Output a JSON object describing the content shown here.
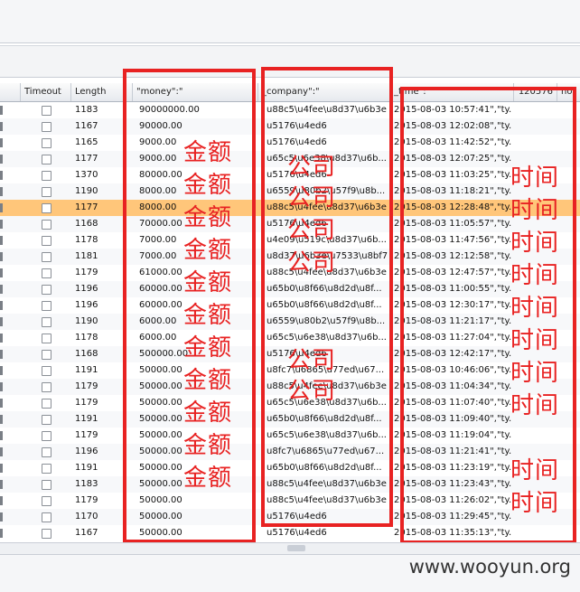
{
  "columns": [
    "Timeout",
    "Length",
    "\"money\":\"",
    "_company\":\"",
    "_time\":",
    "120576",
    "hor"
  ],
  "rows": [
    {
      "length": "1183",
      "money": "90000000.00",
      "company": "u88c5\\u4fee\\u8d37\\u6b3e",
      "time": "2015-08-03 10:57:41\",\"ty..."
    },
    {
      "length": "1167",
      "money": "90000.00",
      "company": "u5176\\u4ed6",
      "time": "2015-08-03 12:02:08\",\"ty..."
    },
    {
      "length": "1165",
      "money": "9000.00",
      "company": "u5176\\u4ed6",
      "time": "2015-08-03 11:42:52\",\"ty..."
    },
    {
      "length": "1177",
      "money": "9000.00",
      "company": "u65c5\\u6e38\\u8d37\\u6b...",
      "time": "2015-08-03 12:07:25\",\"ty..."
    },
    {
      "length": "1370",
      "money": "80000.00",
      "company": "u5176\\u4ed6",
      "time": "2015-08-03 11:03:25\",\"ty..."
    },
    {
      "length": "1190",
      "money": "8000.00",
      "company": "u6559\\u80b2\\u57f9\\u8b...",
      "time": "2015-08-03 11:18:21\",\"ty..."
    },
    {
      "length": "1177",
      "money": "8000.00",
      "company": "u88c5\\u4fee\\u8d37\\u6b3e",
      "time": "2015-08-03 12:28:48\",\"ty..."
    },
    {
      "length": "1168",
      "money": "70000.00",
      "company": "u5176\\u4ed6",
      "time": "2015-08-03 11:05:57\",\"ty..."
    },
    {
      "length": "1178",
      "money": "7000.00",
      "company": "u4e09\\u519c\\u8d37\\u6b...",
      "time": "2015-08-03 11:47:56\",\"ty..."
    },
    {
      "length": "1181",
      "money": "7000.00",
      "company": "u8d37\\u6b3e\\u7533\\u8bf7",
      "time": "2015-08-03 12:12:58\",\"ty..."
    },
    {
      "length": "1179",
      "money": "61000.00",
      "company": "u88c5\\u4fee\\u8d37\\u6b3e",
      "time": "2015-08-03 12:47:57\",\"ty..."
    },
    {
      "length": "1196",
      "money": "60000.00",
      "company": "u65b0\\u8f66\\u8d2d\\u8f...",
      "time": "2015-08-03 11:00:55\",\"ty..."
    },
    {
      "length": "1196",
      "money": "60000.00",
      "company": "u65b0\\u8f66\\u8d2d\\u8f...",
      "time": "2015-08-03 12:30:17\",\"ty..."
    },
    {
      "length": "1190",
      "money": "6000.00",
      "company": "u6559\\u80b2\\u57f9\\u8b...",
      "time": "2015-08-03 11:21:17\",\"ty..."
    },
    {
      "length": "1178",
      "money": "6000.00",
      "company": "u65c5\\u6e38\\u8d37\\u6b...",
      "time": "2015-08-03 11:27:04\",\"ty..."
    },
    {
      "length": "1168",
      "money": "500000.00",
      "company": "u5176\\u4ed6",
      "time": "2015-08-03 12:42:17\",\"ty..."
    },
    {
      "length": "1191",
      "money": "50000.00",
      "company": "u8fc7\\u6865\\u77ed\\u67...",
      "time": "2015-08-03 10:46:06\",\"ty..."
    },
    {
      "length": "1179",
      "money": "50000.00",
      "company": "u88c5\\u4fee\\u8d37\\u6b3e",
      "time": "2015-08-03 11:04:34\",\"ty..."
    },
    {
      "length": "1179",
      "money": "50000.00",
      "company": "u65c5\\u6e38\\u8d37\\u6b...",
      "time": "2015-08-03 11:07:40\",\"ty..."
    },
    {
      "length": "1191",
      "money": "50000.00",
      "company": "u65b0\\u8f66\\u8d2d\\u8f...",
      "time": "2015-08-03 11:09:40\",\"ty..."
    },
    {
      "length": "1179",
      "money": "50000.00",
      "company": "u65c5\\u6e38\\u8d37\\u6b...",
      "time": "2015-08-03 11:19:04\",\"ty..."
    },
    {
      "length": "1196",
      "money": "50000.00",
      "company": "u8fc7\\u6865\\u77ed\\u67...",
      "time": "2015-08-03 11:21:41\",\"ty..."
    },
    {
      "length": "1191",
      "money": "50000.00",
      "company": "u65b0\\u8f66\\u8d2d\\u8f...",
      "time": "2015-08-03 11:23:19\",\"ty..."
    },
    {
      "length": "1183",
      "money": "50000.00",
      "company": "u88c5\\u4fee\\u8d37\\u6b3e",
      "time": "2015-08-03 11:23:43\",\"ty..."
    },
    {
      "length": "1179",
      "money": "50000.00",
      "company": "u88c5\\u4fee\\u8d37\\u6b3e",
      "time": "2015-08-03 11:26:02\",\"ty..."
    },
    {
      "length": "1170",
      "money": "50000.00",
      "company": "u5176\\u4ed6",
      "time": "2015-08-03 11:29:45\",\"ty..."
    },
    {
      "length": "1167",
      "money": "50000.00",
      "company": "u5176\\u4ed6",
      "time": "2015-08-03 11:35:13\",\"ty..."
    }
  ],
  "selected_row": 6,
  "annotations": {
    "money_label": "金额",
    "company_label": "公司",
    "time_label": "时间",
    "color": "#e82222"
  },
  "selection_color": "#ffc67a",
  "watermark": "www.wooyun.org"
}
